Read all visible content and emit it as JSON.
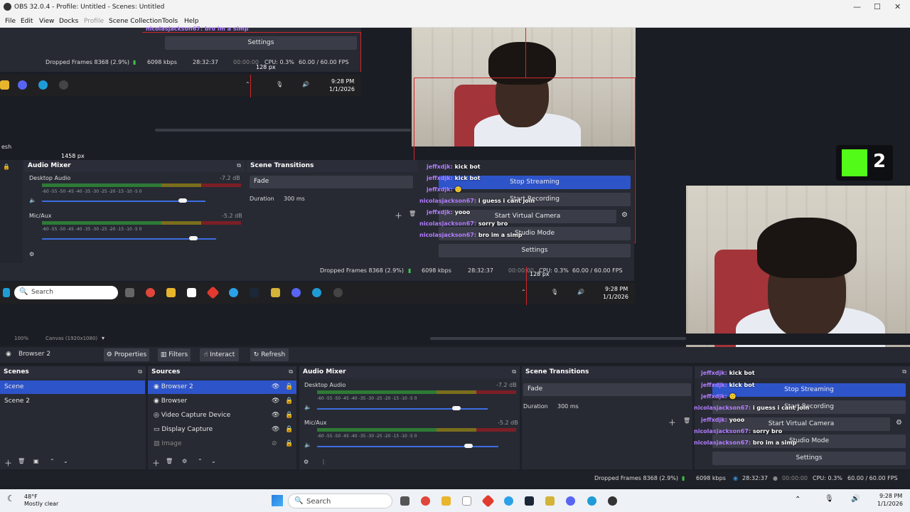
{
  "window": {
    "title": "OBS 32.0.4 - Profile: Untitled - Scenes: Untitled",
    "controls": [
      "—",
      "☐",
      "✕"
    ]
  },
  "menu": [
    "File",
    "Edit",
    "View",
    "Docks",
    "Profile",
    "Scene Collection",
    "Tools",
    "Help"
  ],
  "preview": {
    "top_settings_label": "Settings",
    "top_status": {
      "dropped": "Dropped Frames 8368 (2.9%)",
      "kbps": "6098 kbps",
      "time": "28:32:37",
      "rec_time": "00:00:00",
      "cpu": "CPU: 0.3%",
      "fps": "60.00 / 60.00 FPS"
    },
    "px_label_top": "128 px",
    "px_label_left": "1458 px",
    "px_label_mid": "128 px",
    "partial_label": "esh",
    "top_chat_line": "nicolasjackson67: bro im a simp",
    "top_clock": {
      "time": "9:28 PM",
      "date": "1/1/2026"
    },
    "kick_badge": "2",
    "nested": {
      "audio_mixer": {
        "title": "Audio Mixer",
        "channels": [
          {
            "name": "Desktop Audio",
            "db": "-7.2 dB",
            "level": 0.86
          },
          {
            "name": "Mic/Aux",
            "db": "-5.2 dB",
            "level": 0.83
          }
        ],
        "ticks": "-60  -55  -50  -45  -40  -35  -30  -25  -20  -15  -10  -5  0"
      },
      "scene_transitions": {
        "title": "Scene Transitions",
        "type": "Fade",
        "duration_label": "Duration",
        "duration": "300 ms"
      },
      "controls": {
        "stop_streaming": "Stop Streaming",
        "start_recording": "Start Recording",
        "start_virtual_camera": "Start Virtual Camera",
        "studio_mode": "Studio Mode",
        "settings": "Settings"
      },
      "status": {
        "dropped": "Dropped Frames 8368 (2.9%)",
        "kbps": "6098 kbps",
        "time": "28:32:37",
        "rec_time": "00:00:00",
        "cpu": "CPU: 0.3%",
        "fps": "60.00 / 60.00 FPS"
      },
      "taskbar_search": "Search",
      "clock": {
        "time": "9:28 PM",
        "date": "1/1/2026"
      }
    },
    "chat": [
      {
        "user": "jeffxdjk:",
        "msg": "kick bot"
      },
      {
        "user": "jeffxdjk:",
        "msg": "kick bot"
      },
      {
        "user": "jeffxdjk:",
        "msg": "🙂"
      },
      {
        "user": "nicolasjackson67:",
        "msg": "i guess i cant join"
      },
      {
        "user": "jeffxdjk:",
        "msg": "yooo"
      },
      {
        "user": "nicolasjackson67:",
        "msg": "sorry bro"
      },
      {
        "user": "nicolasjackson67:",
        "msg": "bro im a simp"
      }
    ]
  },
  "zoom_row": {
    "zoom": "100%",
    "canvas": "Canvas (1920x1080)"
  },
  "source_toolbar": {
    "selected_source": "Browser 2",
    "properties": "Properties",
    "filters": "Filters",
    "interact": "Interact",
    "refresh": "Refresh"
  },
  "scenes": {
    "title": "Scenes",
    "items": [
      "Scene",
      "Scene 2"
    ]
  },
  "sources": {
    "title": "Sources",
    "items": [
      "Browser 2",
      "Browser",
      "Video Capture Device",
      "Display Capture",
      "Image"
    ]
  },
  "audio_mixer": {
    "title": "Audio Mixer",
    "channels": [
      {
        "name": "Desktop Audio",
        "db": "-7.2 dB",
        "level": 0.86
      },
      {
        "name": "Mic/Aux",
        "db": "-5.2 dB",
        "level": 0.83
      }
    ],
    "ticks": "-60  -55  -50  -45  -40  -35  -30  -25  -20  -15  -10  -5  0"
  },
  "scene_transitions": {
    "title": "Scene Transitions",
    "type": "Fade",
    "duration_label": "Duration",
    "duration": "300 ms"
  },
  "controls": {
    "stop_streaming": "Stop Streaming",
    "start_recording": "Start Recording",
    "start_virtual_camera": "Start Virtual Camera",
    "studio_mode": "Studio Mode",
    "settings": "Settings"
  },
  "status": {
    "dropped": "Dropped Frames 8368 (2.9%)",
    "kbps": "6098 kbps",
    "time": "28:32:37",
    "rec_time": "00:00:00",
    "cpu": "CPU: 0.3%",
    "fps": "60.00 / 60.00 FPS"
  },
  "taskbar": {
    "weather_temp": "48°F",
    "weather_desc": "Mostly clear",
    "search": "Search",
    "time": "9:28 PM",
    "date": "1/1/2026"
  },
  "colors": {
    "accent": "#2e54c9",
    "selection": "#d3262b",
    "chat_user": "#b27cff"
  }
}
